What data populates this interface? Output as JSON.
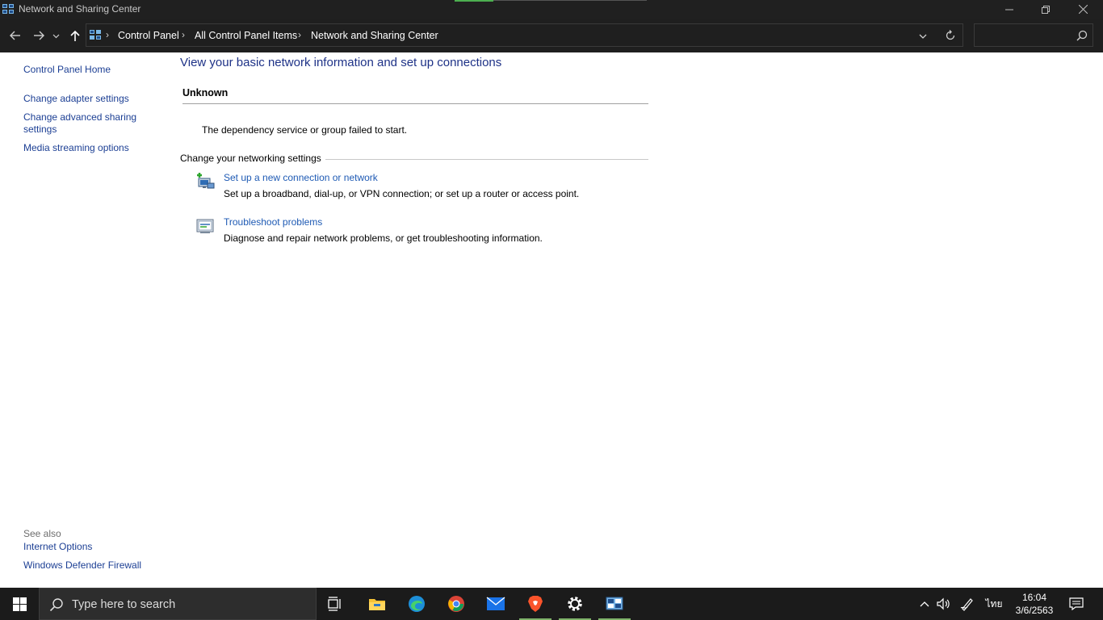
{
  "window": {
    "title": "Network and Sharing Center"
  },
  "address_bar": {
    "crumbs": [
      "Control Panel",
      "All Control Panel Items",
      "Network and Sharing Center"
    ],
    "search_placeholder": ""
  },
  "left_pane": {
    "home": "Control Panel Home",
    "links": [
      "Change adapter settings",
      "Change advanced sharing settings",
      "Media streaming options"
    ],
    "see_also_title": "See also",
    "see_also_links": [
      "Internet Options",
      "Windows Defender Firewall"
    ]
  },
  "main": {
    "heading": "View your basic network information and set up connections",
    "network_name": "Unknown",
    "dependency_message": "The dependency service or group failed to start.",
    "section_title": "Change your networking settings",
    "tasks": [
      {
        "icon": "network-setup-icon",
        "title": "Set up a new connection or network",
        "description": "Set up a broadband, dial-up, or VPN connection; or set up a router or access point."
      },
      {
        "icon": "troubleshoot-icon",
        "title": "Troubleshoot problems",
        "description": "Diagnose and repair network problems, or get troubleshooting information."
      }
    ]
  },
  "taskbar": {
    "search_placeholder": "Type here to search",
    "apps": [
      "task-view-icon",
      "file-explorer-icon",
      "edge-icon",
      "chrome-icon",
      "mail-icon",
      "brave-icon",
      "settings-icon",
      "control-panel-icon"
    ],
    "language": "ไทย",
    "time": "16:04",
    "date": "3/6/2563"
  },
  "colors": {
    "link": "#1c3f94",
    "heading": "#1e3287",
    "titlebar": "#202020",
    "taskbar": "#1b1b1b",
    "running_indicator": "#7fb36a"
  }
}
